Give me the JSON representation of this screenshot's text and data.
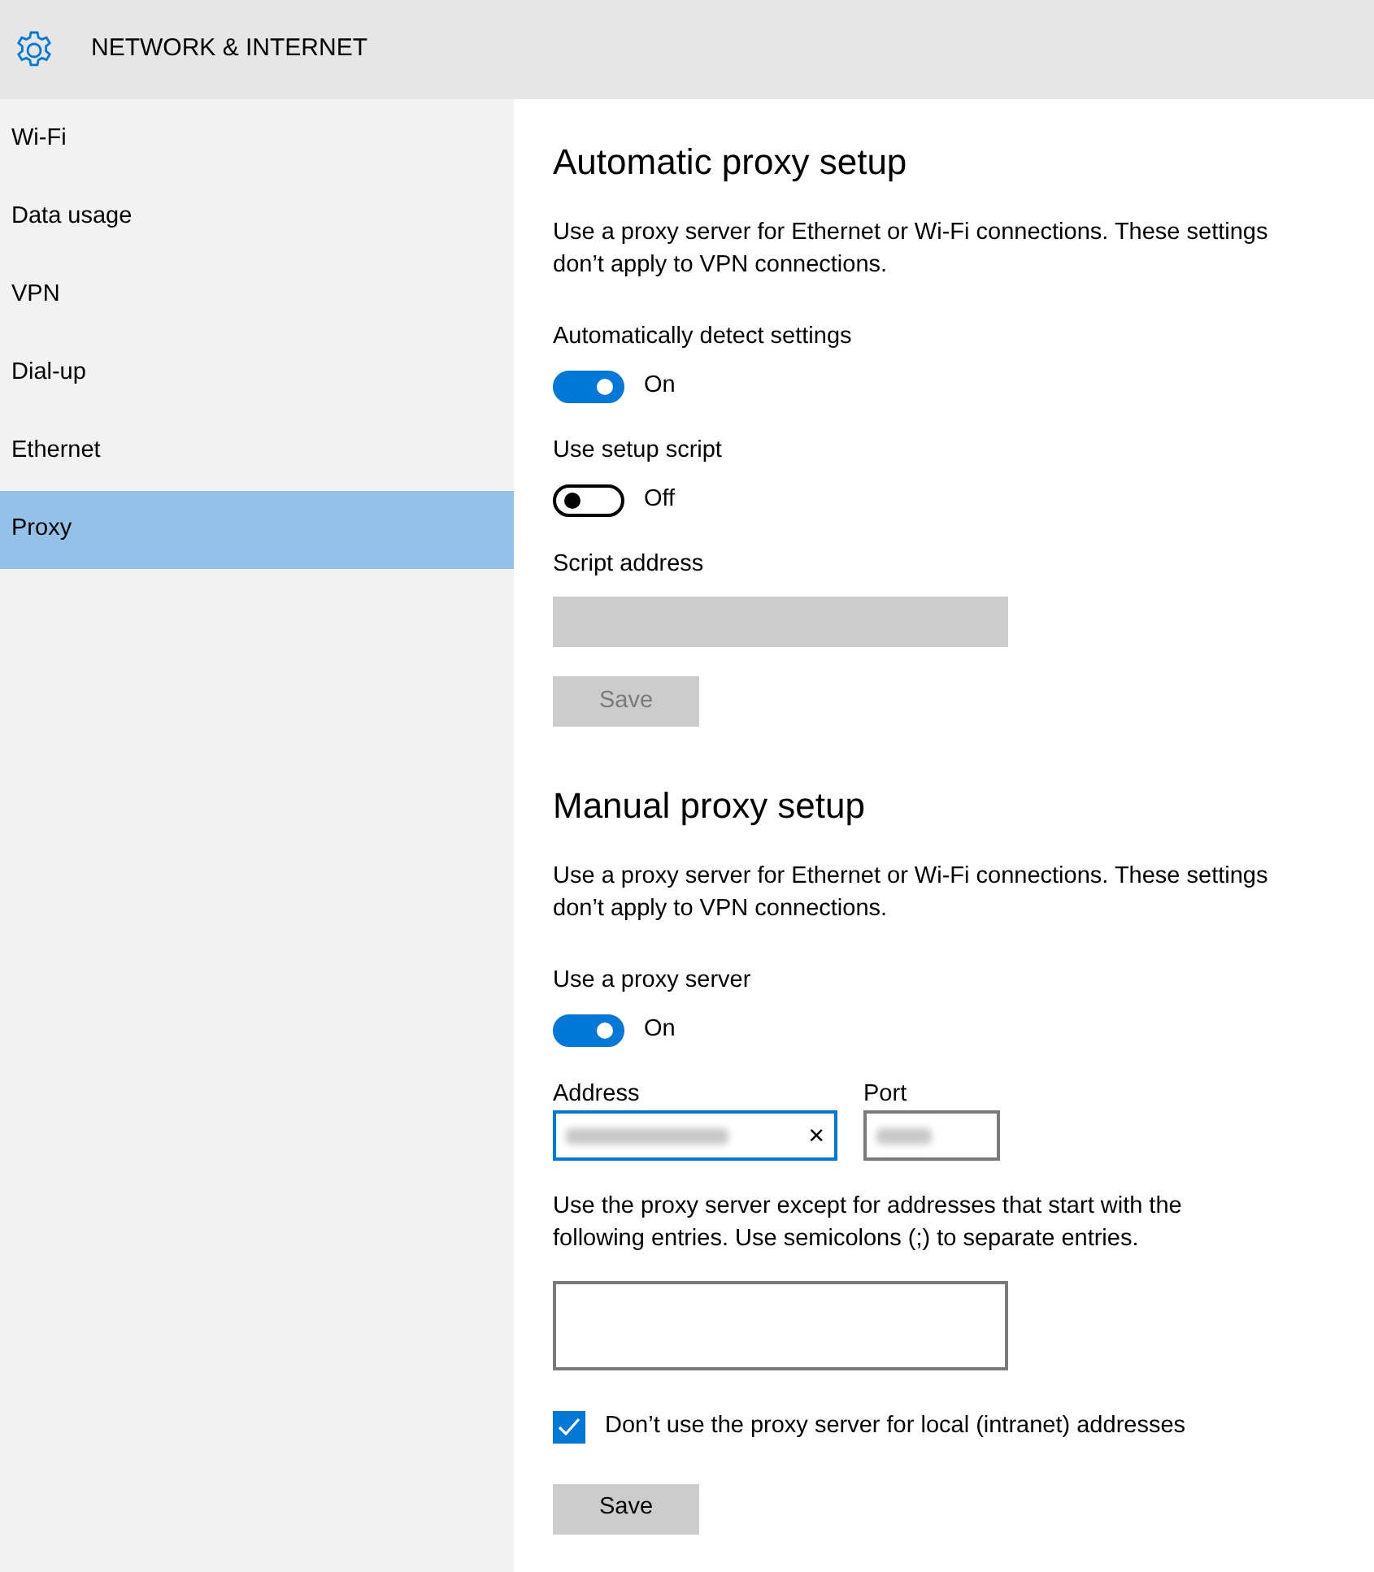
{
  "header": {
    "title": "NETWORK & INTERNET"
  },
  "sidebar": {
    "items": [
      {
        "label": "Wi-Fi",
        "selected": false
      },
      {
        "label": "Data usage",
        "selected": false
      },
      {
        "label": "VPN",
        "selected": false
      },
      {
        "label": "Dial-up",
        "selected": false
      },
      {
        "label": "Ethernet",
        "selected": false
      },
      {
        "label": "Proxy",
        "selected": true
      }
    ]
  },
  "sections": [
    {
      "heading": "Automatic proxy setup",
      "description": "Use a proxy server for Ethernet or Wi-Fi connections. These settings don’t apply to VPN connections.",
      "controls": [
        {
          "kind": "toggle",
          "label": "Automatically detect settings",
          "on": true,
          "state_label": "On"
        },
        {
          "kind": "toggle",
          "label": "Use setup script",
          "on": false,
          "state_label": "Off"
        },
        {
          "kind": "textfield",
          "label": "Script address",
          "disabled": true
        },
        {
          "kind": "button",
          "label": "Save",
          "disabled": true
        }
      ]
    },
    {
      "heading": "Manual proxy setup",
      "description": "Use a proxy server for Ethernet or Wi-Fi connections. These settings don’t apply to VPN connections.",
      "controls": [
        {
          "kind": "toggle",
          "label": "Use a proxy server",
          "on": true,
          "state_label": "On"
        },
        {
          "kind": "address_port",
          "address": {
            "label": "Address",
            "focused": true,
            "clear": "×"
          },
          "port": {
            "label": "Port",
            "focused": false
          }
        },
        {
          "kind": "textarea",
          "label": "Use the proxy server except for addresses that start with the following entries. Use semicolons (;) to separate entries."
        },
        {
          "kind": "checkbox",
          "label": "Don’t use the proxy server for local (intranet) addresses",
          "checked": true
        },
        {
          "kind": "button",
          "label": "Save",
          "disabled": false
        }
      ]
    }
  ]
}
